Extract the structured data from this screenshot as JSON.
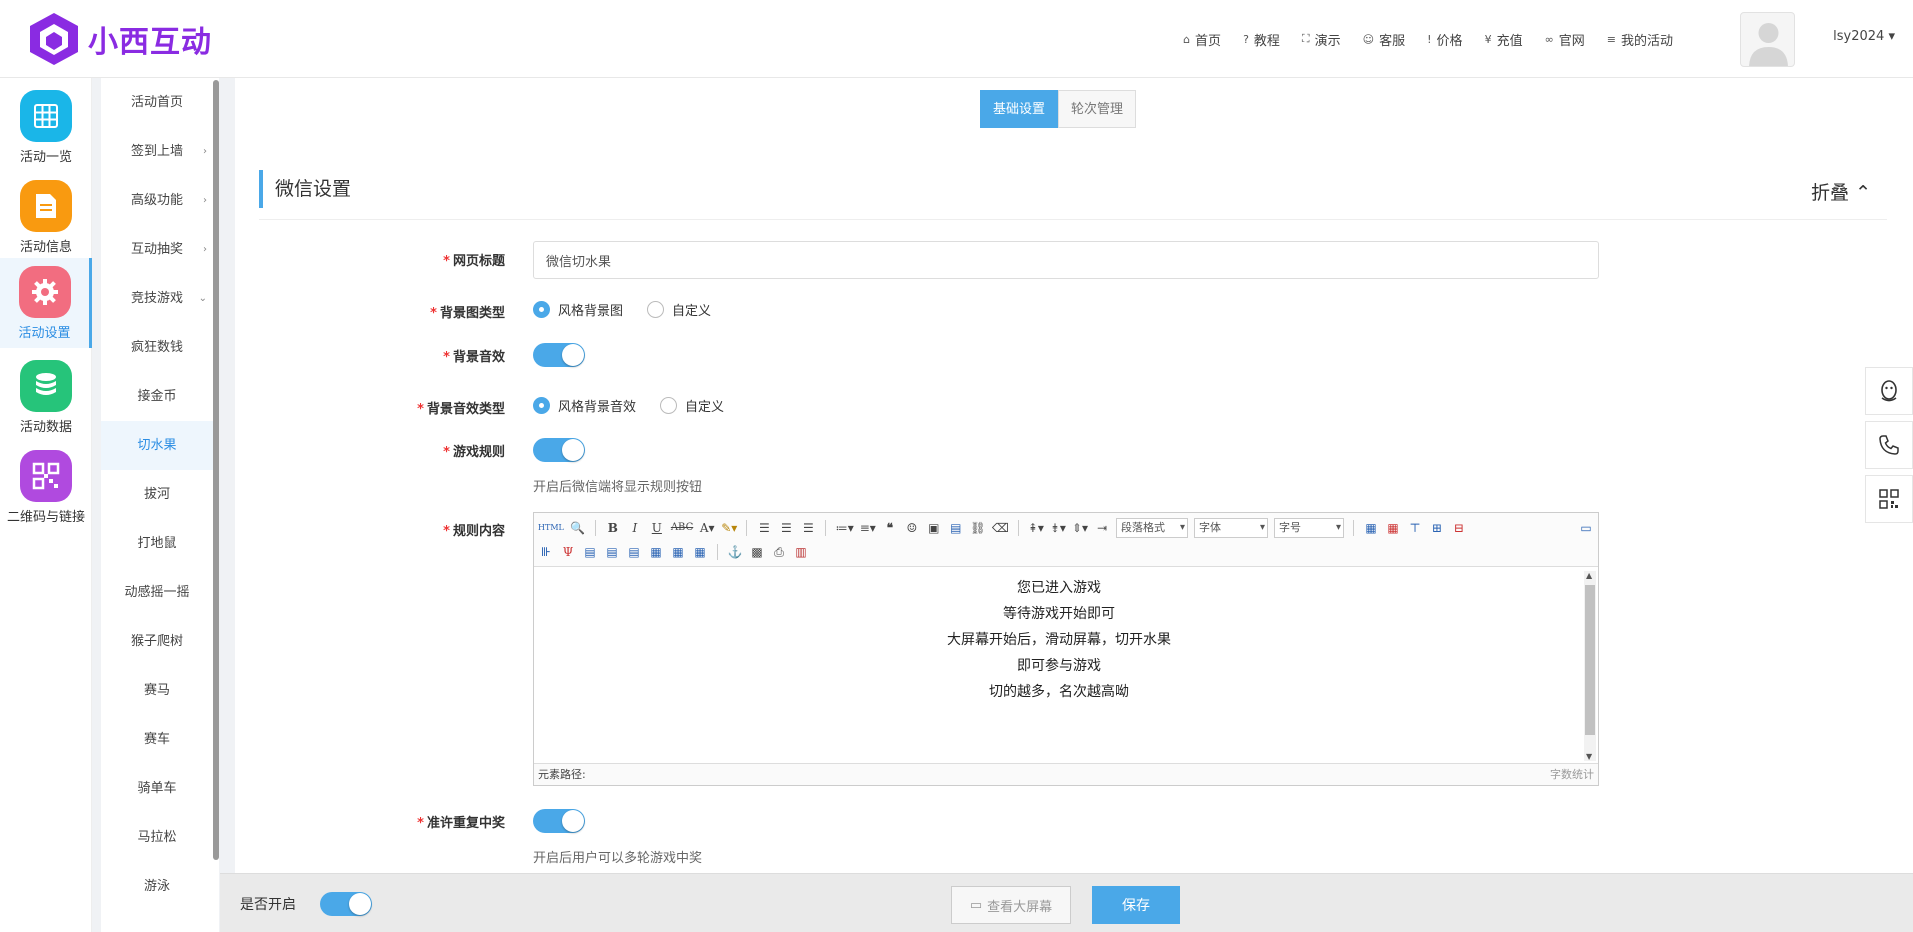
{
  "brand": {
    "name": "小西互动",
    "color": "#8a2be2"
  },
  "topnav": [
    {
      "icon": "home-icon",
      "glyph": "⌂",
      "label": "首页"
    },
    {
      "icon": "help-icon",
      "glyph": "?",
      "label": "教程"
    },
    {
      "icon": "expand-icon",
      "glyph": "⛶",
      "label": "演示"
    },
    {
      "icon": "smile-icon",
      "glyph": "☺",
      "label": "客服"
    },
    {
      "icon": "info-icon",
      "glyph": "!",
      "label": "价格"
    },
    {
      "icon": "yen-icon",
      "glyph": "¥",
      "label": "充值"
    },
    {
      "icon": "link-icon",
      "glyph": "∞",
      "label": "官网"
    },
    {
      "icon": "list-icon",
      "glyph": "≡",
      "label": "我的活动"
    }
  ],
  "user": {
    "name": "lsy2024"
  },
  "iconbar": [
    {
      "label": "活动一览",
      "color": "#1ab6e8",
      "icon": "grid-icon",
      "active": false
    },
    {
      "label": "活动信息",
      "color": "#f99a10",
      "icon": "document-icon",
      "active": false
    },
    {
      "label": "活动设置",
      "color": "#f26d80",
      "icon": "gear-icon",
      "active": true
    },
    {
      "label": "活动数据",
      "color": "#26c47a",
      "icon": "database-icon",
      "active": false
    },
    {
      "label": "二维码与链接",
      "color": "#b04adf",
      "icon": "qrcode-icon",
      "active": false
    }
  ],
  "subbar": [
    {
      "label": "活动首页",
      "arrow": ""
    },
    {
      "label": "签到上墙",
      "arrow": "›"
    },
    {
      "label": "高级功能",
      "arrow": "›"
    },
    {
      "label": "互动抽奖",
      "arrow": "›"
    },
    {
      "label": "竞技游戏",
      "arrow": "⌄"
    },
    {
      "label": "疯狂数钱",
      "arrow": ""
    },
    {
      "label": "接金币",
      "arrow": ""
    },
    {
      "label": "切水果",
      "arrow": "",
      "active": true
    },
    {
      "label": "拔河",
      "arrow": ""
    },
    {
      "label": "打地鼠",
      "arrow": ""
    },
    {
      "label": "动感摇一摇",
      "arrow": ""
    },
    {
      "label": "猴子爬树",
      "arrow": ""
    },
    {
      "label": "赛马",
      "arrow": ""
    },
    {
      "label": "赛车",
      "arrow": ""
    },
    {
      "label": "骑单车",
      "arrow": ""
    },
    {
      "label": "马拉松",
      "arrow": ""
    },
    {
      "label": "游泳",
      "arrow": ""
    }
  ],
  "tabs": {
    "basic": "基础设置",
    "rounds": "轮次管理"
  },
  "section": {
    "title": "微信设置",
    "fold": "折叠 ⌃"
  },
  "form": {
    "page_title_label": "网页标题",
    "page_title_value": "微信切水果",
    "bg_type_label": "背景图类型",
    "bg_type_opt1": "风格背景图",
    "bg_type_opt2": "自定义",
    "bg_music_label": "背景音效",
    "bg_music_type_label": "背景音效类型",
    "bg_music_opt1": "风格背景音效",
    "bg_music_opt2": "自定义",
    "rules_label": "游戏规则",
    "rules_hint": "开启后微信端将显示规则按钮",
    "rules_content_label": "规则内容",
    "repeat_label": "准许重复中奖",
    "repeat_hint": "开启后用户可以多轮游戏中奖"
  },
  "editor": {
    "lines": [
      "您已进入游戏",
      "等待游戏开始即可",
      "大屏幕开始后，滑动屏幕，切开水果",
      "即可参与游戏",
      "切的越多，名次越高呦"
    ],
    "para_select": "段落格式",
    "font_select": "字体",
    "size_select": "字号",
    "status_path": "元素路径:",
    "status_count": "字数统计"
  },
  "bottom": {
    "enabled_label": "是否开启",
    "view_screen": "查看大屏幕",
    "save": "保存"
  },
  "accent": "#4aa8e8"
}
